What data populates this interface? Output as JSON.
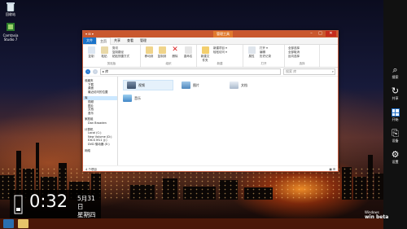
{
  "desktop": {
    "icons": [
      {
        "label": "回收站",
        "icon": "recycle-bin-icon"
      },
      {
        "label": "Camtasia Studio 7",
        "icon": "camtasia-icon"
      }
    ]
  },
  "explorer": {
    "quick_access": "▾ ⊞ ▾",
    "context_tab": "管理工具",
    "caption_buttons": {
      "minimize": "–",
      "maximize": "□",
      "close": "✕"
    },
    "tabs": [
      "文件",
      "主页",
      "共享",
      "查看",
      "管理"
    ],
    "ribbon": {
      "groups": [
        {
          "name": "剪贴板",
          "buttons": [
            "复制",
            "粘贴"
          ],
          "items": [
            "剪切",
            "复制路径",
            "粘贴快捷方式"
          ]
        },
        {
          "name": "组织",
          "buttons": [
            "移动到",
            "复制到",
            "删除",
            "重命名"
          ]
        },
        {
          "name": "新建",
          "buttons": [
            "新建文件夹"
          ],
          "items": [
            "新建项目 ▾",
            "轻松访问 ▾"
          ]
        },
        {
          "name": "打开",
          "buttons": [
            "属性"
          ],
          "items": [
            "打开 ▾",
            "编辑",
            "历史记录"
          ]
        },
        {
          "name": "选择",
          "items": [
            "全部选择",
            "全部取消",
            "反向选择"
          ]
        }
      ]
    },
    "address": {
      "path": "▸ 库",
      "search_placeholder": "搜索 库"
    },
    "nav_pane": {
      "items": [
        {
          "label": "收藏夹",
          "indent": 0
        },
        {
          "label": "下载",
          "indent": 1
        },
        {
          "label": "桌面",
          "indent": 1
        },
        {
          "label": "最近访问的位置",
          "indent": 1
        },
        {
          "label": "库",
          "indent": 0,
          "selected": true
        },
        {
          "label": "视频",
          "indent": 1
        },
        {
          "label": "图片",
          "indent": 1
        },
        {
          "label": "文档",
          "indent": 1
        },
        {
          "label": "音乐",
          "indent": 1
        },
        {
          "label": "家庭组",
          "indent": 0
        },
        {
          "label": "Dan Broaden",
          "indent": 1
        },
        {
          "label": "计算机",
          "indent": 0
        },
        {
          "label": "Local (C:)",
          "indent": 1
        },
        {
          "label": "New Volume (D:)",
          "indent": 1
        },
        {
          "label": "EXCS M11 (J:)",
          "indent": 1
        },
        {
          "label": "DVD 驱动器 (E:)",
          "indent": 1
        },
        {
          "label": "网络",
          "indent": 0
        }
      ]
    },
    "files": [
      {
        "label": "视频",
        "icon": "video-library-icon",
        "selected": true
      },
      {
        "label": "图片",
        "icon": "pictures-library-icon"
      },
      {
        "label": "文档",
        "icon": "documents-library-icon"
      },
      {
        "label": "音乐",
        "icon": "music-library-icon"
      }
    ],
    "status": {
      "count": "4 个项目",
      "views": "▦ ☰"
    }
  },
  "charms": [
    {
      "label": "搜索",
      "icon": "search-icon",
      "glyph": "⌕"
    },
    {
      "label": "共享",
      "icon": "share-icon",
      "glyph": "↻"
    },
    {
      "label": "开始",
      "icon": "windows-start-icon",
      "glyph": ""
    },
    {
      "label": "设备",
      "icon": "devices-icon",
      "glyph": "⎘"
    },
    {
      "label": "设置",
      "icon": "settings-gear-icon",
      "glyph": "⚙"
    }
  ],
  "clock": {
    "time": "0:32",
    "date": "5月31日",
    "weekday": "星期四"
  },
  "brand": {
    "line1": "Windows",
    "line2": "win beta"
  },
  "colors": {
    "accent": "#c9582e",
    "charms_bg": "#111111",
    "start": "#1e6fc9"
  }
}
